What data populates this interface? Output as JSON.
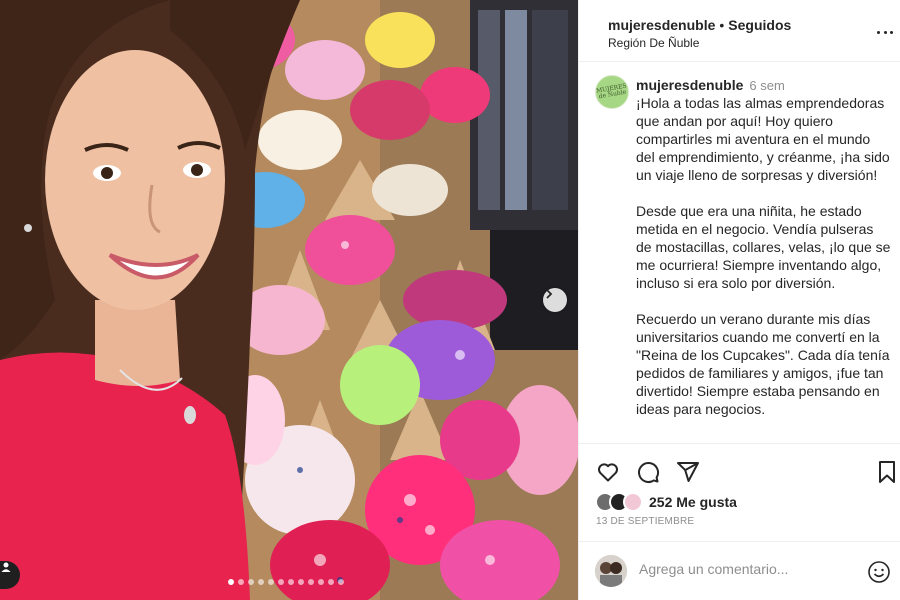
{
  "photo": {
    "alt_subject": "selfie with colorful fabric products on wooden display",
    "carousel_dots": 12,
    "active_dot": 0,
    "icons": {
      "next": "chevron-right-icon",
      "tag": "person-tag-icon"
    }
  },
  "header": {
    "username": "mujeresdenuble",
    "separator": "•",
    "follow_status": "Seguidos",
    "location": "Región De Ñuble"
  },
  "caption": {
    "avatar_text": "MUJERES de Ñuble",
    "username": "mujeresdenuble",
    "time_ago": "6 sem",
    "paragraphs": [
      "¡Hola a todas las almas emprendedoras que andan por aquí! Hoy quiero compartirles mi aventura en el mundo del emprendimiento, y créanme, ¡ha sido un viaje lleno de sorpresas y diversión!",
      "Desde que era una niñita, he estado metida en el negocio. Vendía pulseras de mostacillas, collares, velas, ¡lo que se me ocurriera! Siempre inventando algo, incluso si era solo por diversión.",
      "Recuerdo un verano durante mis días universitarios cuando me convertí en la \"Reina de los Cupcakes\". Cada día tenía pedidos de familiares y amigos, ¡fue tan divertido! Siempre estaba pensando en ideas para negocios."
    ]
  },
  "actions": {
    "icons": [
      "heart-icon",
      "comment-icon",
      "share-icon",
      "bookmark-icon"
    ]
  },
  "likes": {
    "text": "252 Me gusta"
  },
  "date": "13 DE SEPTIEMBRE",
  "comment": {
    "placeholder": "Agrega un comentario..."
  },
  "colors": {
    "text": "#262626",
    "muted": "#8e8e8e",
    "border": "#efefef",
    "sweater": "#e8234e",
    "avatar_green": "#a6d785"
  }
}
